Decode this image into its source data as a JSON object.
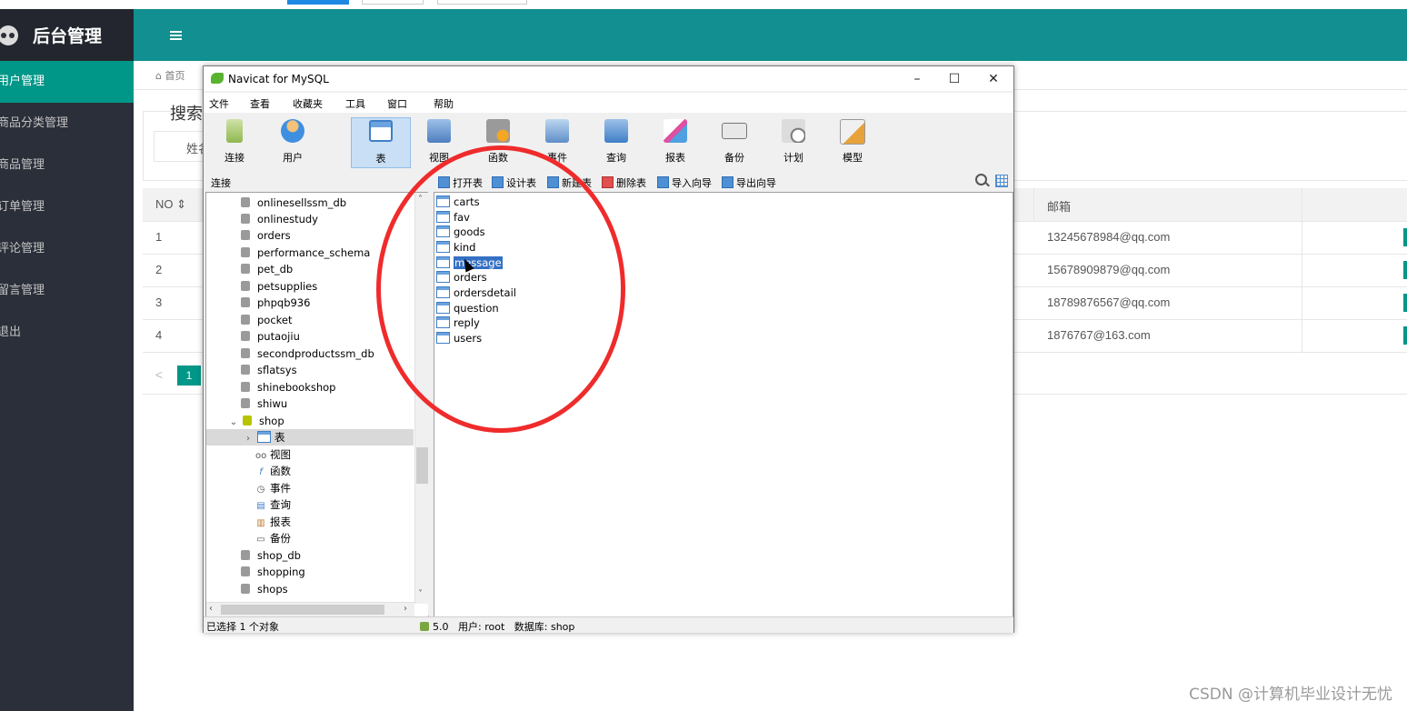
{
  "admin": {
    "logo_text": "后台管理",
    "menu": [
      "用户管理",
      "商品分类管理",
      "商品管理",
      "订单管理",
      "评论管理",
      "留言管理",
      "退出"
    ],
    "home_tab": "首页",
    "search_legend": "搜索",
    "name_label": "姓名",
    "table": {
      "headers": {
        "no": "NO ⇕",
        "email": "邮箱"
      },
      "rows": [
        {
          "no": "1",
          "email": "13245678984@qq.com"
        },
        {
          "no": "2",
          "email": "15678909879@qq.com"
        },
        {
          "no": "3",
          "email": "18789876567@qq.com"
        },
        {
          "no": "4",
          "email": "1876767@163.com"
        }
      ]
    },
    "pager": {
      "prev": "<",
      "page": "1"
    },
    "accent_color": "#009688",
    "header_color": "#118f91",
    "sidebar_color": "#2b2f3a"
  },
  "watermark": "CSDN @计算机毕业设计无忧",
  "navicat": {
    "title": "Navicat for MySQL",
    "controls": {
      "minimize": "–",
      "maximize": "☐",
      "close": "✕"
    },
    "menu": [
      "文件",
      "查看",
      "收藏夹",
      "工具",
      "窗口",
      "帮助"
    ],
    "toolbar": [
      "连接",
      "用户",
      "表",
      "视图",
      "函数",
      "事件",
      "查询",
      "报表",
      "备份",
      "计划",
      "模型"
    ],
    "connection_label": "连接",
    "subtoolbar": [
      "打开表",
      "设计表",
      "新建表",
      "删除表",
      "导入向导",
      "导出向导"
    ],
    "tree": [
      {
        "label": "onlinesellssm_db",
        "type": "db"
      },
      {
        "label": "onlinestudy",
        "type": "db"
      },
      {
        "label": "orders",
        "type": "db"
      },
      {
        "label": "performance_schema",
        "type": "db"
      },
      {
        "label": "pet_db",
        "type": "db"
      },
      {
        "label": "petsupplies",
        "type": "db"
      },
      {
        "label": "phpqb936",
        "type": "db"
      },
      {
        "label": "pocket",
        "type": "db"
      },
      {
        "label": "putaojiu",
        "type": "db"
      },
      {
        "label": "secondproductssm_db",
        "type": "db"
      },
      {
        "label": "sflatsys",
        "type": "db"
      },
      {
        "label": "shinebookshop",
        "type": "db"
      },
      {
        "label": "shiwu",
        "type": "db"
      },
      {
        "label": "shop",
        "type": "db-open"
      },
      {
        "label": "表",
        "type": "tables"
      },
      {
        "label": "视图",
        "type": "views"
      },
      {
        "label": "函数",
        "type": "functions"
      },
      {
        "label": "事件",
        "type": "events"
      },
      {
        "label": "查询",
        "type": "queries"
      },
      {
        "label": "报表",
        "type": "reports"
      },
      {
        "label": "备份",
        "type": "backups"
      },
      {
        "label": "shop_db",
        "type": "db"
      },
      {
        "label": "shopping",
        "type": "db"
      },
      {
        "label": "shops",
        "type": "db"
      }
    ],
    "tables": [
      "carts",
      "fav",
      "goods",
      "kind",
      "message",
      "orders",
      "ordersdetail",
      "question",
      "reply",
      "users"
    ],
    "selected_table": "message",
    "status": {
      "left": "已选择 1 个对象",
      "version": "5.0",
      "user": "用户: root",
      "database": "数据库: shop"
    }
  },
  "annotation_color": "#ef2b2b"
}
